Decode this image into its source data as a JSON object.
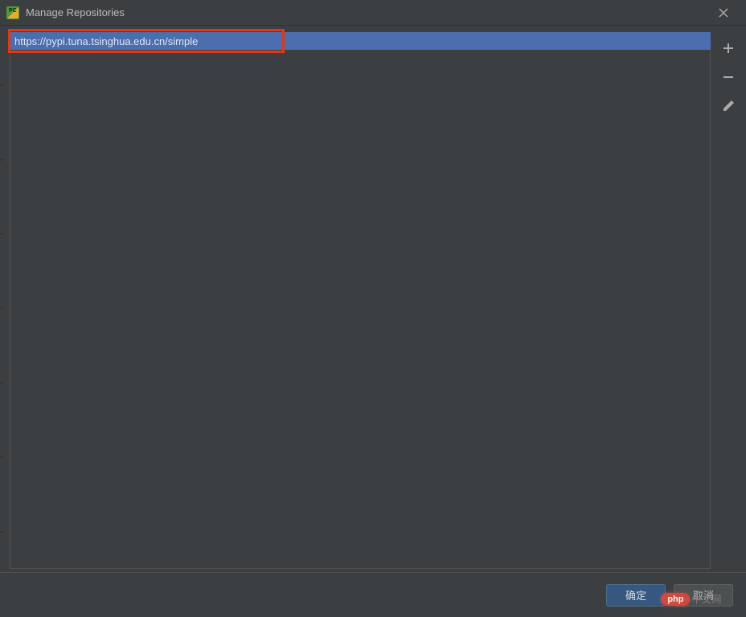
{
  "titlebar": {
    "title": "Manage Repositories"
  },
  "repositories": {
    "selected_url": "https://pypi.tuna.tsinghua.edu.cn/simple"
  },
  "toolbar": {
    "add_tooltip": "Add",
    "remove_tooltip": "Remove",
    "edit_tooltip": "Edit"
  },
  "buttons": {
    "ok_label": "确定",
    "cancel_label": "取消"
  },
  "watermark": {
    "pill": "php",
    "text": "中文网"
  }
}
